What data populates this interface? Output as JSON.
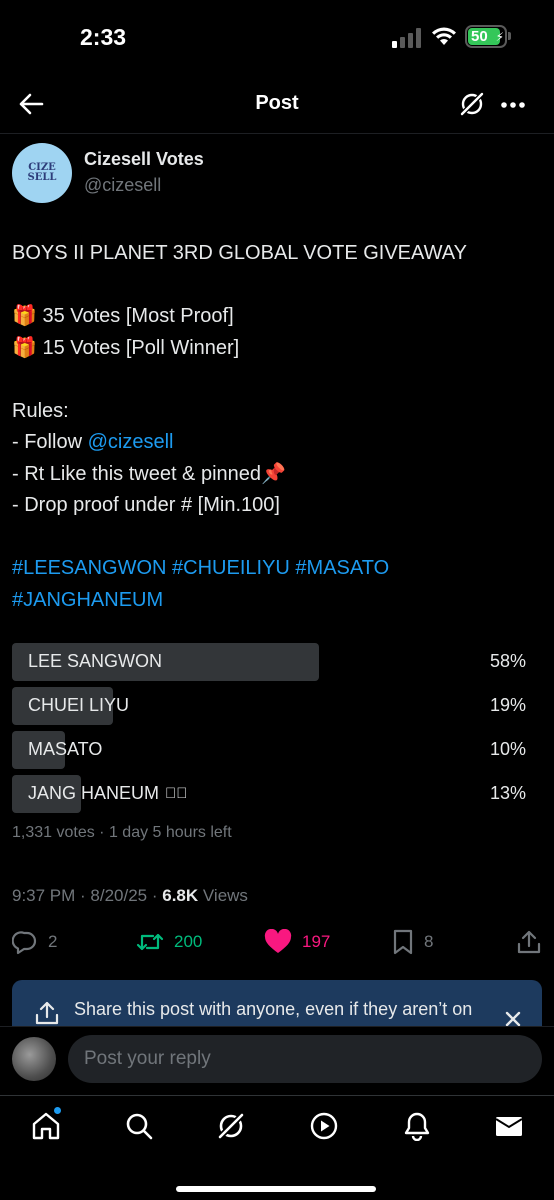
{
  "status_bar": {
    "time": "2:33",
    "battery": "50"
  },
  "header": {
    "title": "Post"
  },
  "author": {
    "avatar_text_top": "CIZE",
    "avatar_text_bottom": "SELL",
    "name": "Cizesell Votes",
    "handle": "@cizesell"
  },
  "tweet": {
    "title_line": "BOYS II PLANET 3RD GLOBAL VOTE GIVEAWAY",
    "prize_1": "🎁 35 Votes [Most Proof]",
    "prize_2": "🎁 15 Votes [Poll Winner]",
    "rules_heading": "Rules:",
    "rule_1_prefix": "- Follow ",
    "rule_1_mention": "@cizesell",
    "rule_2": "- Rt Like this tweet & pinned📌",
    "rule_3": "- Drop proof under # [Min.100]",
    "hashtags_line_1": "#LEESANGWON #CHUEILIYU #MASATO",
    "hashtags_line_2": "#JANGHANEUM"
  },
  "poll": {
    "options": [
      {
        "label": "LEE SANGWON",
        "percent_text": "58%",
        "percent": 58,
        "checked": false
      },
      {
        "label": "CHUEI LIYU",
        "percent_text": "19%",
        "percent": 19,
        "checked": false
      },
      {
        "label": "MASATO",
        "percent_text": "10%",
        "percent": 10,
        "checked": false
      },
      {
        "label": "JANG HANEUM",
        "percent_text": "13%",
        "percent": 13,
        "checked": true
      }
    ],
    "meta": "1,331 votes · 1 day 5 hours left"
  },
  "timestamp": {
    "time_date": "9:37 PM · 8/20/25 · ",
    "views_count": "6.8K",
    "views_label": " Views"
  },
  "actions": {
    "replies": "2",
    "reposts": "200",
    "likes": "197",
    "bookmarks": "8"
  },
  "share_banner": {
    "text": "Share this post with anyone, even if they aren’t on X yet"
  },
  "reply": {
    "placeholder": "Post your reply"
  },
  "colors": {
    "accent": "#1d9bf0",
    "repost": "#00ba7c",
    "like": "#f91880",
    "battery": "#34c759"
  }
}
